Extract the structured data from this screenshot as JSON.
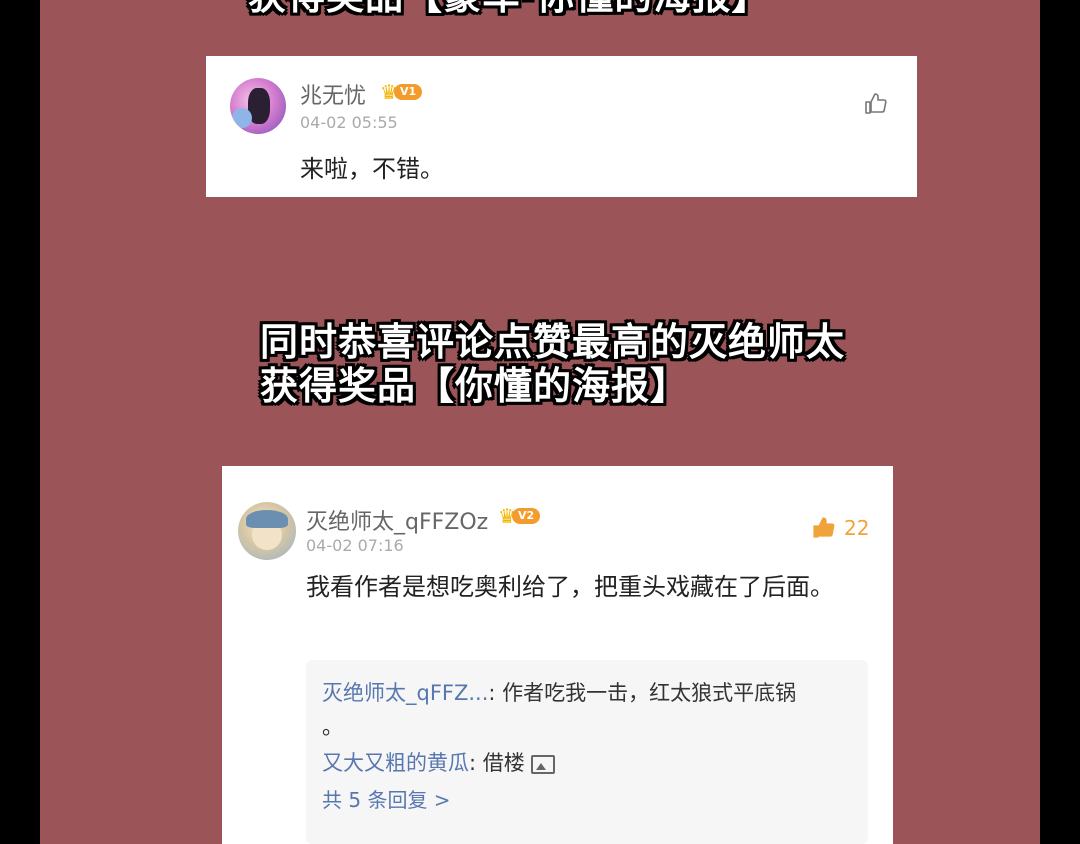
{
  "captions": {
    "top": "获得奖品【豪车·你懂的海报】",
    "mid_line1": "同时恭喜评论点赞最高的灭绝师太",
    "mid_line2": "获得奖品【你懂的海报】"
  },
  "comment1": {
    "username": "兆无忧",
    "level": "V1",
    "time": "04-02 05:55",
    "content": "来啦，不错。",
    "like_icon": "thumbs-up-icon"
  },
  "comment2": {
    "username": "灭绝师太_qFFZOz",
    "level": "V2",
    "time": "04-02 07:16",
    "like_count": "22",
    "like_icon": "thumbs-up-icon",
    "content": "我看作者是想吃奥利给了，把重头戏藏在了后面。",
    "replies": [
      {
        "name": "灭绝师太_qFFZ...",
        "text": "作者吃我一击，红太狼式平底锅"
      },
      {
        "name": "又大又粗的黄瓜",
        "text": "借楼"
      }
    ],
    "reply_cont": "。",
    "more_replies": "共 5 条回复 >"
  },
  "colors": {
    "panel_bg": "#9b5558",
    "like_active": "#f0a33a",
    "reply_name": "#5877b0"
  }
}
